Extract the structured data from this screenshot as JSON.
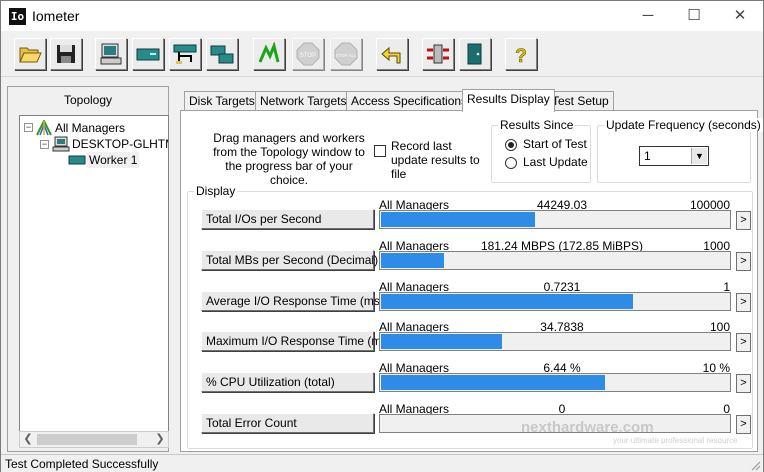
{
  "window": {
    "title": "Iometer",
    "app_icon_text": "Io",
    "minimize": "─",
    "maximize": "☐",
    "close": "✕"
  },
  "toolbar": {
    "buttons": [
      {
        "name": "open-config",
        "icon": "folder-open-icon"
      },
      {
        "name": "save-config",
        "icon": "floppy-disk-icon"
      },
      {
        "name": "start-display",
        "icon": "computer-icon"
      },
      {
        "name": "new-disk-worker",
        "icon": "disk-worker-icon"
      },
      {
        "name": "new-network-worker",
        "icon": "network-worker-icon"
      },
      {
        "name": "duplicate-worker",
        "icon": "duplicate-icon"
      },
      {
        "name": "start-tests",
        "icon": "green-flag-icon"
      },
      {
        "name": "stop-test",
        "icon": "stop-icon",
        "label": "STOP"
      },
      {
        "name": "stop-all",
        "icon": "stop-all-icon",
        "label": "STOP ALL"
      },
      {
        "name": "reset-workers",
        "icon": "reset-arrow-icon"
      },
      {
        "name": "new-manager",
        "icon": "manager-icon"
      },
      {
        "name": "exit",
        "icon": "exit-door-icon"
      },
      {
        "name": "about",
        "icon": "help-icon",
        "label": "?"
      }
    ]
  },
  "topology": {
    "label": "Topology",
    "tree": [
      {
        "label": "All Managers",
        "level": 0
      },
      {
        "label": "DESKTOP-GLHTM",
        "level": 1
      },
      {
        "label": "Worker 1",
        "level": 2
      }
    ]
  },
  "tabs": [
    {
      "label": "Disk Targets",
      "active": false
    },
    {
      "label": "Network Targets",
      "active": false
    },
    {
      "label": "Access Specifications",
      "active": false
    },
    {
      "label": "Results Display",
      "active": true
    },
    {
      "label": "Test Setup",
      "active": false
    }
  ],
  "results": {
    "drag_text": "Drag managers and workers from the Topology window to the progress bar of your choice.",
    "record_label": "Record last update results to file",
    "record_checked": false,
    "results_since": {
      "title": "Results Since",
      "options": [
        "Start of Test",
        "Last Update"
      ],
      "selected": "Start of Test"
    },
    "update_frequency": {
      "title": "Update Frequency (seconds)",
      "value": "1"
    },
    "display_title": "Display",
    "metrics": [
      {
        "label": "Total I/Os per Second",
        "source": "All Managers",
        "value": "44249.03",
        "max": "100000",
        "fill": 0.4425
      },
      {
        "label": "Total MBs per Second (Decimal)",
        "source": "All Managers",
        "value": "181.24 MBPS (172.85 MiBPS)",
        "max": "1000",
        "fill": 0.1812
      },
      {
        "label": "Average I/O Response Time (ms)",
        "source": "All Managers",
        "value": "0.7231",
        "max": "1",
        "fill": 0.7231
      },
      {
        "label": "Maximum I/O Response Time (ms)",
        "source": "All Managers",
        "value": "34.7838",
        "max": "100",
        "fill": 0.3478
      },
      {
        "label": "% CPU Utilization (total)",
        "source": "All Managers",
        "value": "6.44 %",
        "max": "10 %",
        "fill": 0.644
      },
      {
        "label": "Total Error Count",
        "source": "All Managers",
        "value": "0",
        "max": "0",
        "fill": 0
      }
    ],
    "more_glyph": ">"
  },
  "watermark": {
    "text": "nexthardware.com",
    "sub": "your ultimate professional resource"
  },
  "status": {
    "text": "Test Completed Successfully"
  },
  "colors": {
    "bar": "#2f8ce6"
  }
}
